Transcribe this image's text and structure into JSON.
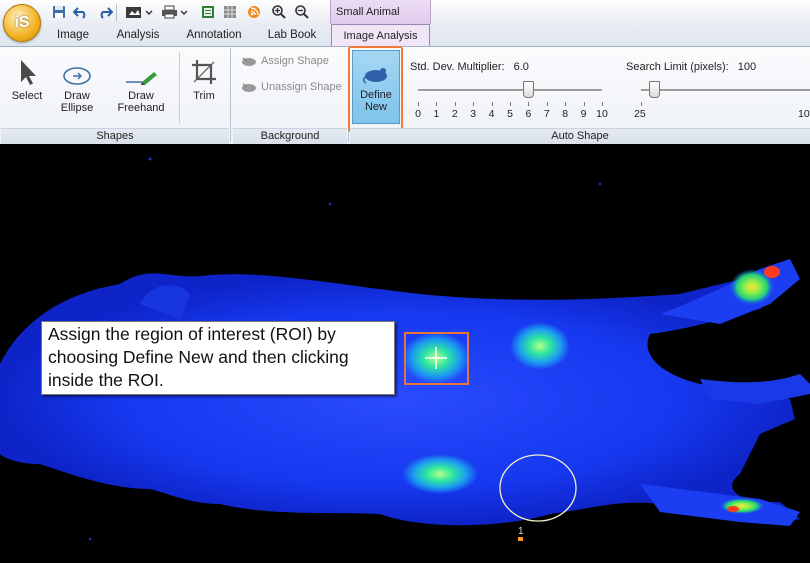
{
  "quick_access": {
    "logo_text": "iS",
    "icons": [
      "save-icon",
      "undo-icon",
      "redo-icon",
      "camera-icon",
      "printer-icon",
      "report-icon",
      "grid-icon",
      "rss-icon",
      "zoom-in-icon",
      "zoom-out-icon"
    ]
  },
  "context_tab_label": "Small Animal",
  "tabs": [
    "Image",
    "Analysis",
    "Annotation",
    "Lab Book",
    "Image Analysis"
  ],
  "ribbon": {
    "shapes": {
      "select_label": "Select",
      "draw_ellipse_label": "Draw\nEllipse",
      "draw_freehand_label": "Draw\nFreehand",
      "trim_label": "Trim",
      "group_label": "Shapes"
    },
    "background": {
      "assign_label": "Assign Shape",
      "unassign_label": "Unassign Shape",
      "group_label": "Background"
    },
    "auto_shape": {
      "define_new_label": "Define\nNew",
      "std_dev_label": "Std. Dev. Multiplier:",
      "std_dev_value": "6.0",
      "std_dev_ticks": [
        "0",
        "1",
        "2",
        "3",
        "4",
        "5",
        "6",
        "7",
        "8",
        "9",
        "10"
      ],
      "std_dev_position": 6.0,
      "search_limit_label": "Search Limit (pixels):",
      "search_limit_value": "100",
      "search_limit_min": "25",
      "search_limit_max": "10",
      "group_label": "Auto Shape"
    }
  },
  "viewer": {
    "callout_text": "Assign the region of interest (ROI) by choosing Define New and then clicking inside the ROI.",
    "roi_number": "1"
  },
  "colors": {
    "highlight": "#f07a3c",
    "define_new_bg": "#8ccbef",
    "context_tab": "#e3d1f0"
  }
}
